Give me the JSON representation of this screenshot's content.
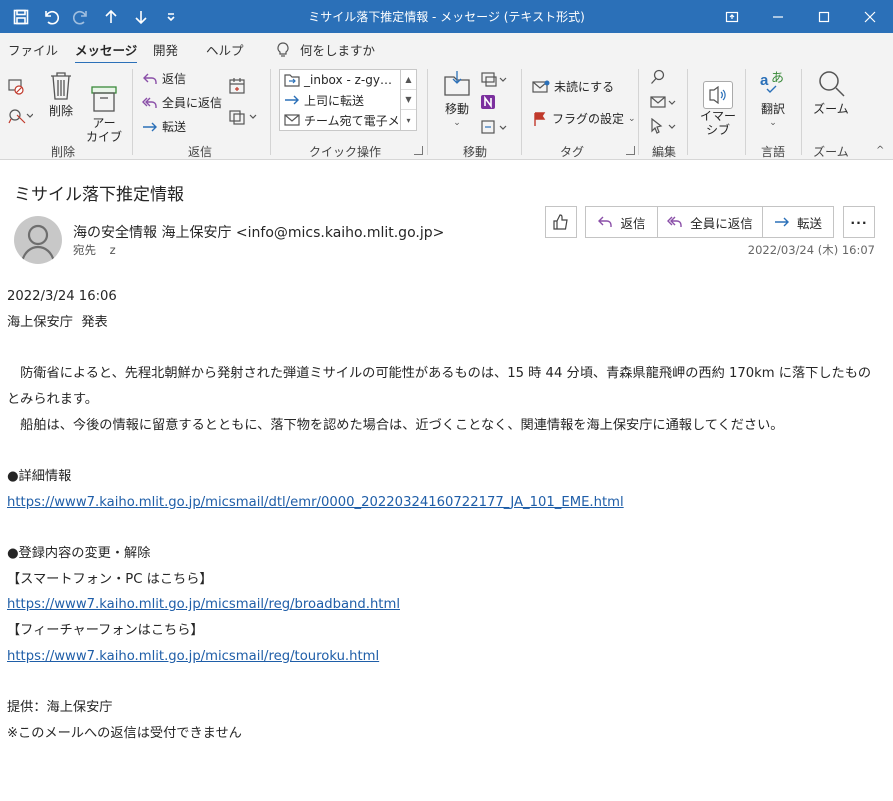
{
  "window": {
    "title": "ミサイル落下推定情報  -  メッセージ (テキスト形式)"
  },
  "tabs": [
    {
      "label": "ファイル"
    },
    {
      "label": "メッセージ"
    },
    {
      "label": "開発"
    },
    {
      "label": "ヘルプ"
    }
  ],
  "tellme": {
    "label": "何をしますか"
  },
  "ribbon": {
    "delete_group": {
      "label": "削除",
      "delete": "削除",
      "archive": "アー\nカイブ"
    },
    "respond_group": {
      "label": "返信",
      "reply": "返信",
      "reply_all": "全員に返信",
      "forward": "転送"
    },
    "quicksteps_group": {
      "label": "クイック操作",
      "items": [
        "_inbox - z-gy…",
        "上司に転送",
        "チーム宛て電子メ…"
      ]
    },
    "move_group": {
      "label": "移動",
      "move": "移動"
    },
    "tags_group": {
      "label": "タグ",
      "mark_unread": "未読にする",
      "flag": "フラグの設定"
    },
    "edit_group": {
      "label": "編集"
    },
    "immersive_group": {
      "label": "イマー\nシブ"
    },
    "language_group": {
      "label": "言語",
      "translate": "翻訳"
    },
    "zoom_group": {
      "label": "ズーム",
      "zoom": "ズーム"
    }
  },
  "message": {
    "subject": "ミサイル落下推定情報",
    "sender": "海の安全情報 海上保安庁 <info@mics.kaiho.mlit.go.jp>",
    "to_label": "宛先",
    "to_value": "z",
    "datetime": "2022/03/24 (木) 16:07",
    "actions": {
      "reply": "返信",
      "reply_all": "全員に返信",
      "forward": "転送"
    }
  },
  "body": {
    "line1": "2022/3/24 16:06",
    "line2": "海上保安庁  発表",
    "para1": "　防衛省によると、先程北朝鮮から発射された弾道ミサイルの可能性があるものは、15 時 44 分頃、青森県龍飛岬の西約 170km に落下したものとみられます。",
    "para2": "　船舶は、今後の情報に留意するとともに、落下物を認めた場合は、近づくことなく、関連情報を海上保安庁に通報してください。",
    "detail_heading": "●詳細情報",
    "detail_link": "https://www7.kaiho.mlit.go.jp/micsmail/dtl/emr/0000_20220324160722177_JA_101_EME.html",
    "reg_heading": "●登録内容の変更・解除",
    "smartphone_heading": "【スマートフォン・PC はこちら】",
    "smartphone_link": "https://www7.kaiho.mlit.go.jp/micsmail/reg/broadband.html",
    "feature_heading": "【フィーチャーフォンはこちら】",
    "feature_link": "https://www7.kaiho.mlit.go.jp/micsmail/reg/touroku.html",
    "provider": "提供：海上保安庁",
    "note": "※このメールへの返信は受付できません"
  }
}
